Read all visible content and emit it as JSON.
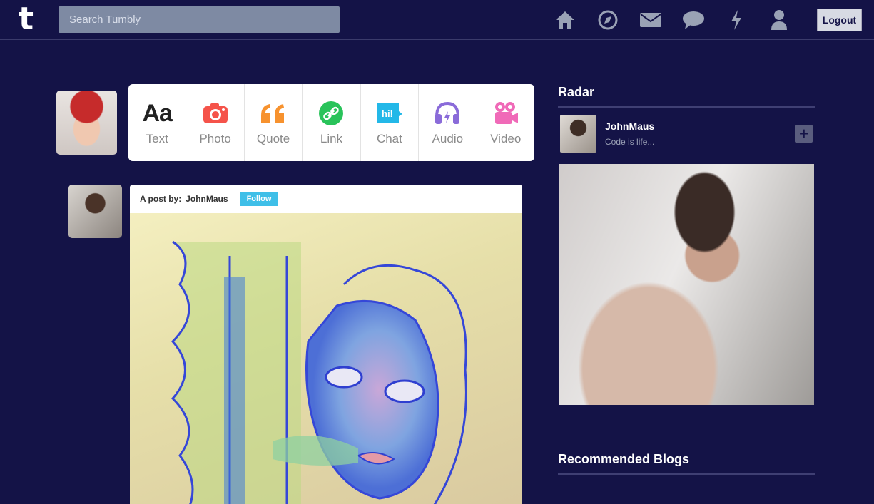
{
  "app": {
    "logo": "t"
  },
  "search": {
    "placeholder": "Search Tumbly"
  },
  "nav": {
    "icons": [
      "home-icon",
      "explore-icon",
      "mail-icon",
      "chat-bubble-icon",
      "activity-icon",
      "account-icon"
    ],
    "logout_label": "Logout",
    "icon_color": "#9aa2b5"
  },
  "post_types": [
    {
      "label": "Text",
      "glyph": "Aa",
      "color": "#222222"
    },
    {
      "label": "Photo",
      "color": "#f5534a"
    },
    {
      "label": "Quote",
      "glyph": "“",
      "color": "#f7922e"
    },
    {
      "label": "Link",
      "color": "#29c35a"
    },
    {
      "label": "Chat",
      "glyph": "hi!",
      "color": "#23b8e8"
    },
    {
      "label": "Audio",
      "color": "#8a6bd9"
    },
    {
      "label": "Video",
      "color": "#f06ab8"
    }
  ],
  "post": {
    "by_label": "A post by:",
    "author": "JohnMaus",
    "follow_label": "Follow"
  },
  "sidebar": {
    "radar_title": "Radar",
    "radar_user": "JohnMaus",
    "radar_desc": "Code is life...",
    "recommended_title": "Recommended Blogs"
  },
  "colors": {
    "background": "#141347",
    "follow": "#3fbfe8",
    "search_bg": "#7e8aa3"
  }
}
